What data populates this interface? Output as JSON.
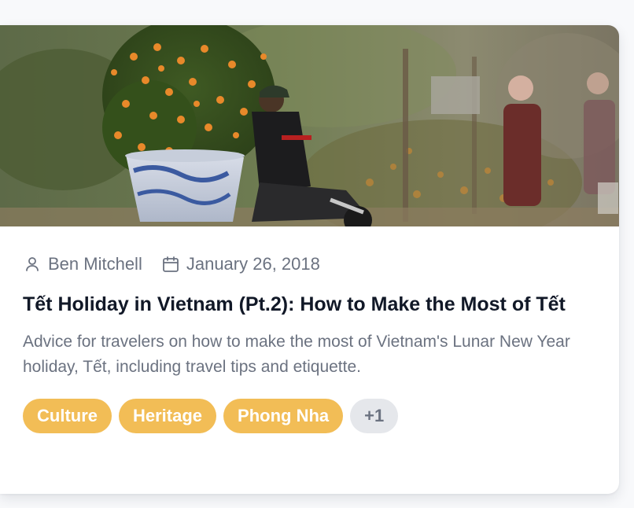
{
  "post": {
    "image_alt": "Man on a motorbike carrying a kumquat tree in a blue and white pot",
    "author": "Ben Mitchell",
    "date": "January 26, 2018",
    "title": "Tết Holiday in Vietnam (Pt.2): How to Make the Most of Tết",
    "description": "Advice for travelers on how to make the most of Vietnam's Lunar New Year holiday, Tết, including travel tips and etiquette.",
    "tags": [
      "Culture",
      "Heritage",
      "Phong Nha"
    ],
    "more_tags": "+1"
  },
  "icons": {
    "author": "user-icon",
    "date": "calendar-icon"
  },
  "colors": {
    "tag_bg": "#f2bd56",
    "tag_text": "#ffffff",
    "more_bg": "#e5e7eb",
    "meta_text": "#6b7280",
    "title_text": "#111827"
  }
}
